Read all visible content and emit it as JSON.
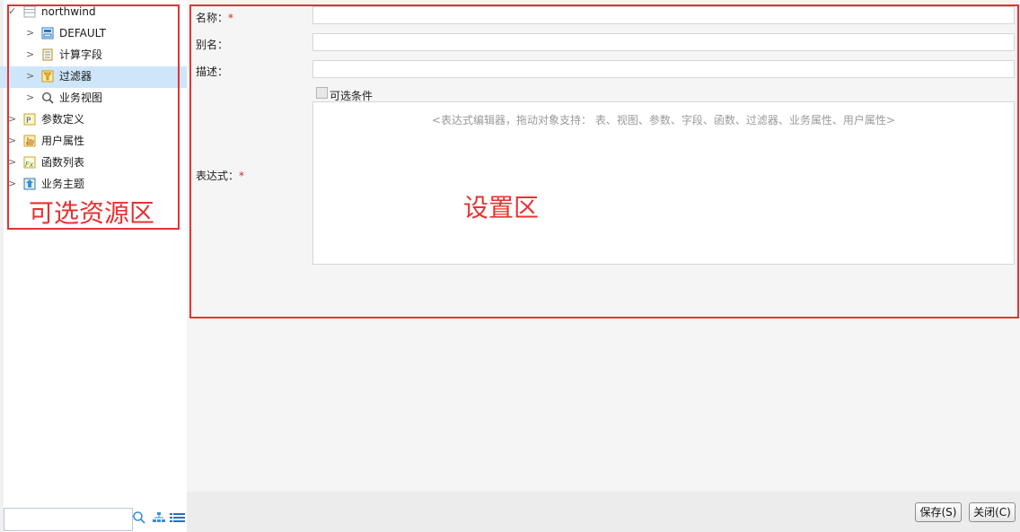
{
  "tree": {
    "root": "northwind",
    "items": [
      {
        "label": "DEFAULT",
        "icon": "table-icon"
      },
      {
        "label": "计算字段",
        "icon": "calc-field-icon"
      },
      {
        "label": "过滤器",
        "icon": "filter-icon"
      },
      {
        "label": "业务视图",
        "icon": "search-icon"
      },
      {
        "label": "参数定义",
        "icon": "param-icon"
      },
      {
        "label": "用户属性",
        "icon": "user-attr-icon"
      },
      {
        "label": "函数列表",
        "icon": "function-icon"
      },
      {
        "label": "业务主题",
        "icon": "business-topic-icon"
      }
    ],
    "selected": "过滤器"
  },
  "annotations": {
    "resource_area": "可选资源区",
    "settings_area": "设置区"
  },
  "form": {
    "name_label": "名称：",
    "alias_label": "别名：",
    "desc_label": "描述：",
    "expr_label": "表达式：",
    "required_mark": "*",
    "optional_condition_label": "可选条件",
    "expr_placeholder": "<表达式编辑器，拖动对象支持： 表、视图、参数、字段、函数、过滤器、业务属性、用户属性>"
  },
  "buttons": {
    "save": "保存(S)",
    "close": "关闭(C)"
  },
  "colors": {
    "annotation": "#e63232",
    "selected_row": "#cde6fa"
  }
}
